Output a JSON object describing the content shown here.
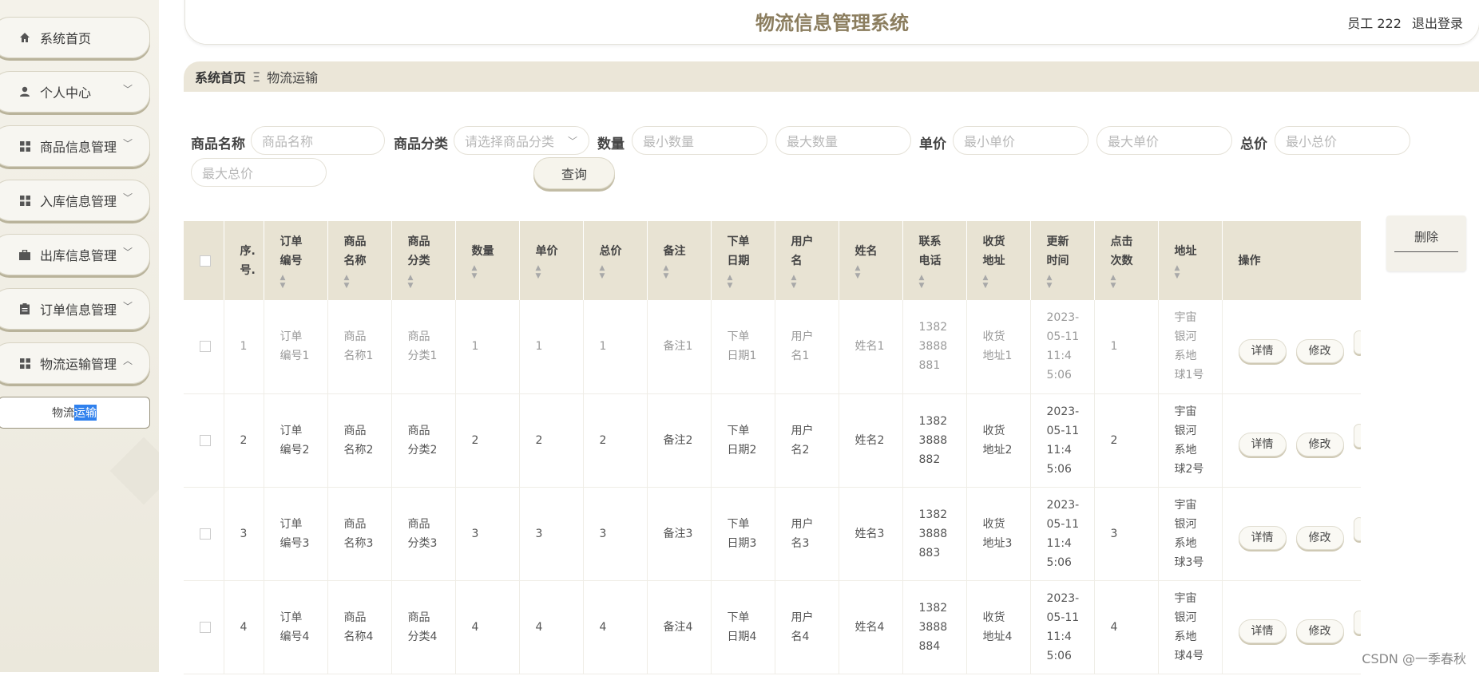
{
  "header": {
    "title": "物流信息管理系统",
    "user": "员工 222",
    "logout": "退出登录"
  },
  "sidebar": {
    "items": [
      {
        "label": "系统首页",
        "icon": "home-icon",
        "has_chevron": false
      },
      {
        "label": "个人中心",
        "icon": "person-icon",
        "has_chevron": true
      },
      {
        "label": "商品信息管理",
        "icon": "grid-icon",
        "has_chevron": true
      },
      {
        "label": "入库信息管理",
        "icon": "grid-icon",
        "has_chevron": true
      },
      {
        "label": "出库信息管理",
        "icon": "briefcase-icon",
        "has_chevron": true
      },
      {
        "label": "订单信息管理",
        "icon": "clipboard-icon",
        "has_chevron": true
      },
      {
        "label": "物流运输管理",
        "icon": "grid-icon",
        "has_chevron": true,
        "expanded": true
      }
    ],
    "sub_item": {
      "label_before": "物流",
      "label_selected": "运输"
    }
  },
  "breadcrumb": {
    "home": "系统首页",
    "separator": "Ξ",
    "current": "物流运输"
  },
  "search": {
    "product_name_label": "商品名称",
    "product_name_placeholder": "商品名称",
    "category_label": "商品分类",
    "category_placeholder": "请选择商品分类",
    "qty_label": "数量",
    "qty_min_placeholder": "最小数量",
    "qty_max_placeholder": "最大数量",
    "price_label": "单价",
    "price_min_placeholder": "最小单价",
    "price_max_placeholder": "最大单价",
    "total_label": "总价",
    "total_min_placeholder": "最小总价",
    "total_max_placeholder": "最大总价",
    "query_button": "查询"
  },
  "actions": {
    "delete": "删除",
    "detail": "详情",
    "edit": "修改"
  },
  "table": {
    "headers": [
      "序.\n号.",
      "订单\n编号",
      "商品\n名称",
      "商品\n分类",
      "数量",
      "单价",
      "总价",
      "备注",
      "下单\n日期",
      "用户\n名",
      "姓名",
      "联系\n电话",
      "收货\n地址",
      "更新\n时间",
      "点击\n次数",
      "地址",
      "操作"
    ],
    "rows": [
      {
        "id": "1",
        "order": "订单\n编号1",
        "name": "商品\n名称1",
        "cat": "商品\n分类1",
        "qty": "1",
        "price": "1",
        "total": "1",
        "note": "备注1",
        "date": "下单\n日期1",
        "user": "用户\n名1",
        "real": "姓名1",
        "phone": "1382\n3888\n881",
        "recv": "收货\n地址1",
        "time": "2023-\n05-11\n11:4\n5:06",
        "clicks": "1",
        "addr": "宇宙\n银河\n系地\n球1号"
      },
      {
        "id": "2",
        "order": "订单\n编号2",
        "name": "商品\n名称2",
        "cat": "商品\n分类2",
        "qty": "2",
        "price": "2",
        "total": "2",
        "note": "备注2",
        "date": "下单\n日期2",
        "user": "用户\n名2",
        "real": "姓名2",
        "phone": "1382\n3888\n882",
        "recv": "收货\n地址2",
        "time": "2023-\n05-11\n11:4\n5:06",
        "clicks": "2",
        "addr": "宇宙\n银河\n系地\n球2号"
      },
      {
        "id": "3",
        "order": "订单\n编号3",
        "name": "商品\n名称3",
        "cat": "商品\n分类3",
        "qty": "3",
        "price": "3",
        "total": "3",
        "note": "备注3",
        "date": "下单\n日期3",
        "user": "用户\n名3",
        "real": "姓名3",
        "phone": "1382\n3888\n883",
        "recv": "收货\n地址3",
        "time": "2023-\n05-11\n11:4\n5:06",
        "clicks": "3",
        "addr": "宇宙\n银河\n系地\n球3号"
      },
      {
        "id": "4",
        "order": "订单\n编号4",
        "name": "商品\n名称4",
        "cat": "商品\n分类4",
        "qty": "4",
        "price": "4",
        "total": "4",
        "note": "备注4",
        "date": "下单\n日期4",
        "user": "用户\n名4",
        "real": "姓名4",
        "phone": "1382\n3888\n884",
        "recv": "收货\n地址4",
        "time": "2023-\n05-11\n11:4\n5:06",
        "clicks": "4",
        "addr": "宇宙\n银河\n系地\n球4号"
      }
    ]
  },
  "watermark": "CSDN @一季春秋"
}
